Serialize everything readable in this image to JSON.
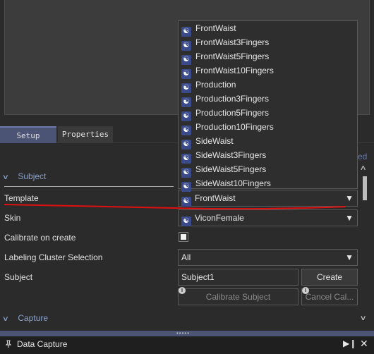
{
  "tabs": [
    {
      "label": "Setup"
    },
    {
      "label": "Properties"
    }
  ],
  "partial_text": "ed",
  "subject_section": {
    "title": "Subject"
  },
  "capture_section": {
    "title": "Capture"
  },
  "fields": {
    "template_label": "Template",
    "template_value": "FrontWaist",
    "skin_label": "Skin",
    "skin_value": "ViconFemale",
    "calibrate_label": "Calibrate on create",
    "labeling_label": "Labeling Cluster Selection",
    "labeling_value": "All",
    "subject_label": "Subject",
    "subject_value": "Subject1"
  },
  "buttons": {
    "create": "Create",
    "calibrate_subject": "Calibrate Subject",
    "cancel_calibration": "Cancel Cal..."
  },
  "dropdown_items": [
    "FrontWaist",
    "FrontWaist3Fingers",
    "FrontWaist5Fingers",
    "FrontWaist10Fingers",
    "Production",
    "Production3Fingers",
    "Production5Fingers",
    "Production10Fingers",
    "SideWaist",
    "SideWaist3Fingers",
    "SideWaist5Fingers",
    "SideWaist10Fingers"
  ],
  "statusbar": {
    "title": "Data Capture"
  },
  "colors": {
    "accent": "#4b5474",
    "annotation": "#e01010"
  },
  "icons": [
    "template-icon",
    "pin-icon",
    "dock-icon",
    "close-icon",
    "info-icon",
    "chevron-down-icon",
    "chevron-up-icon"
  ]
}
